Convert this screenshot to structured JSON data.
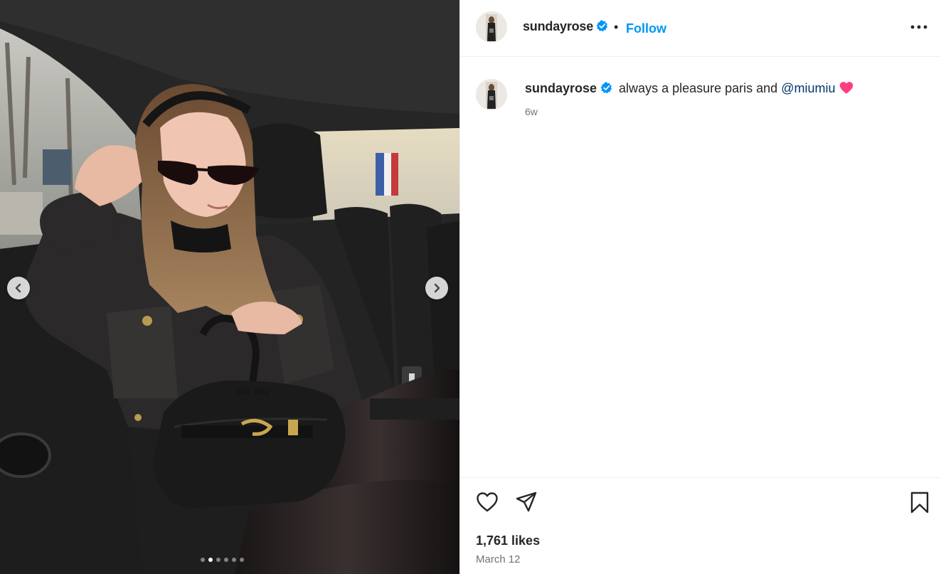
{
  "post": {
    "username": "sundayrose",
    "follow_label": "Follow",
    "bullet": "•",
    "caption_username": "sundayrose",
    "caption_text": " always a pleasure paris and ",
    "mention": "@miumiu",
    "caption_emoji": "pink-heart-emoji",
    "time_ago": "6w",
    "likes": "1,761 likes",
    "date": "March 12"
  },
  "carousel": {
    "total_slides": 6,
    "active_slide": 2
  },
  "colors": {
    "link_blue": "#0095f6",
    "mention": "#00376b",
    "verified": "#0095f6",
    "heart_pink": "#ff3d7f"
  },
  "icons": {
    "verified": "verified-badge-icon",
    "more": "more-options-icon",
    "like": "heart-outline-icon",
    "share": "paper-plane-icon",
    "save": "bookmark-icon",
    "prev": "chevron-left-icon",
    "next": "chevron-right-icon"
  }
}
